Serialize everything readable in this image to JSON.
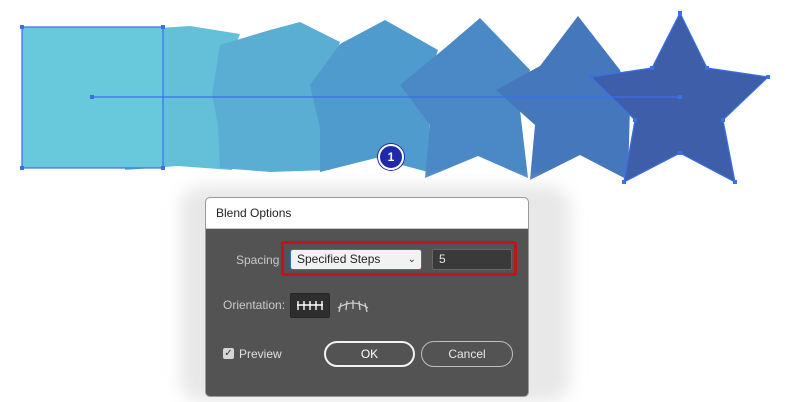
{
  "canvas": {
    "step_badge": "1",
    "colors": {
      "square": "#69c9dc",
      "star": "#3f5eaa",
      "selection": "#3a6fe6"
    }
  },
  "dialog": {
    "title": "Blend Options",
    "spacing_label": "Spacing",
    "spacing_value": "Specified Steps",
    "steps_value": "5",
    "orientation_label": "Orientation:",
    "preview_label": "Preview",
    "preview_checked": true,
    "ok_label": "OK",
    "cancel_label": "Cancel",
    "highlight_color": "#c4121a"
  }
}
